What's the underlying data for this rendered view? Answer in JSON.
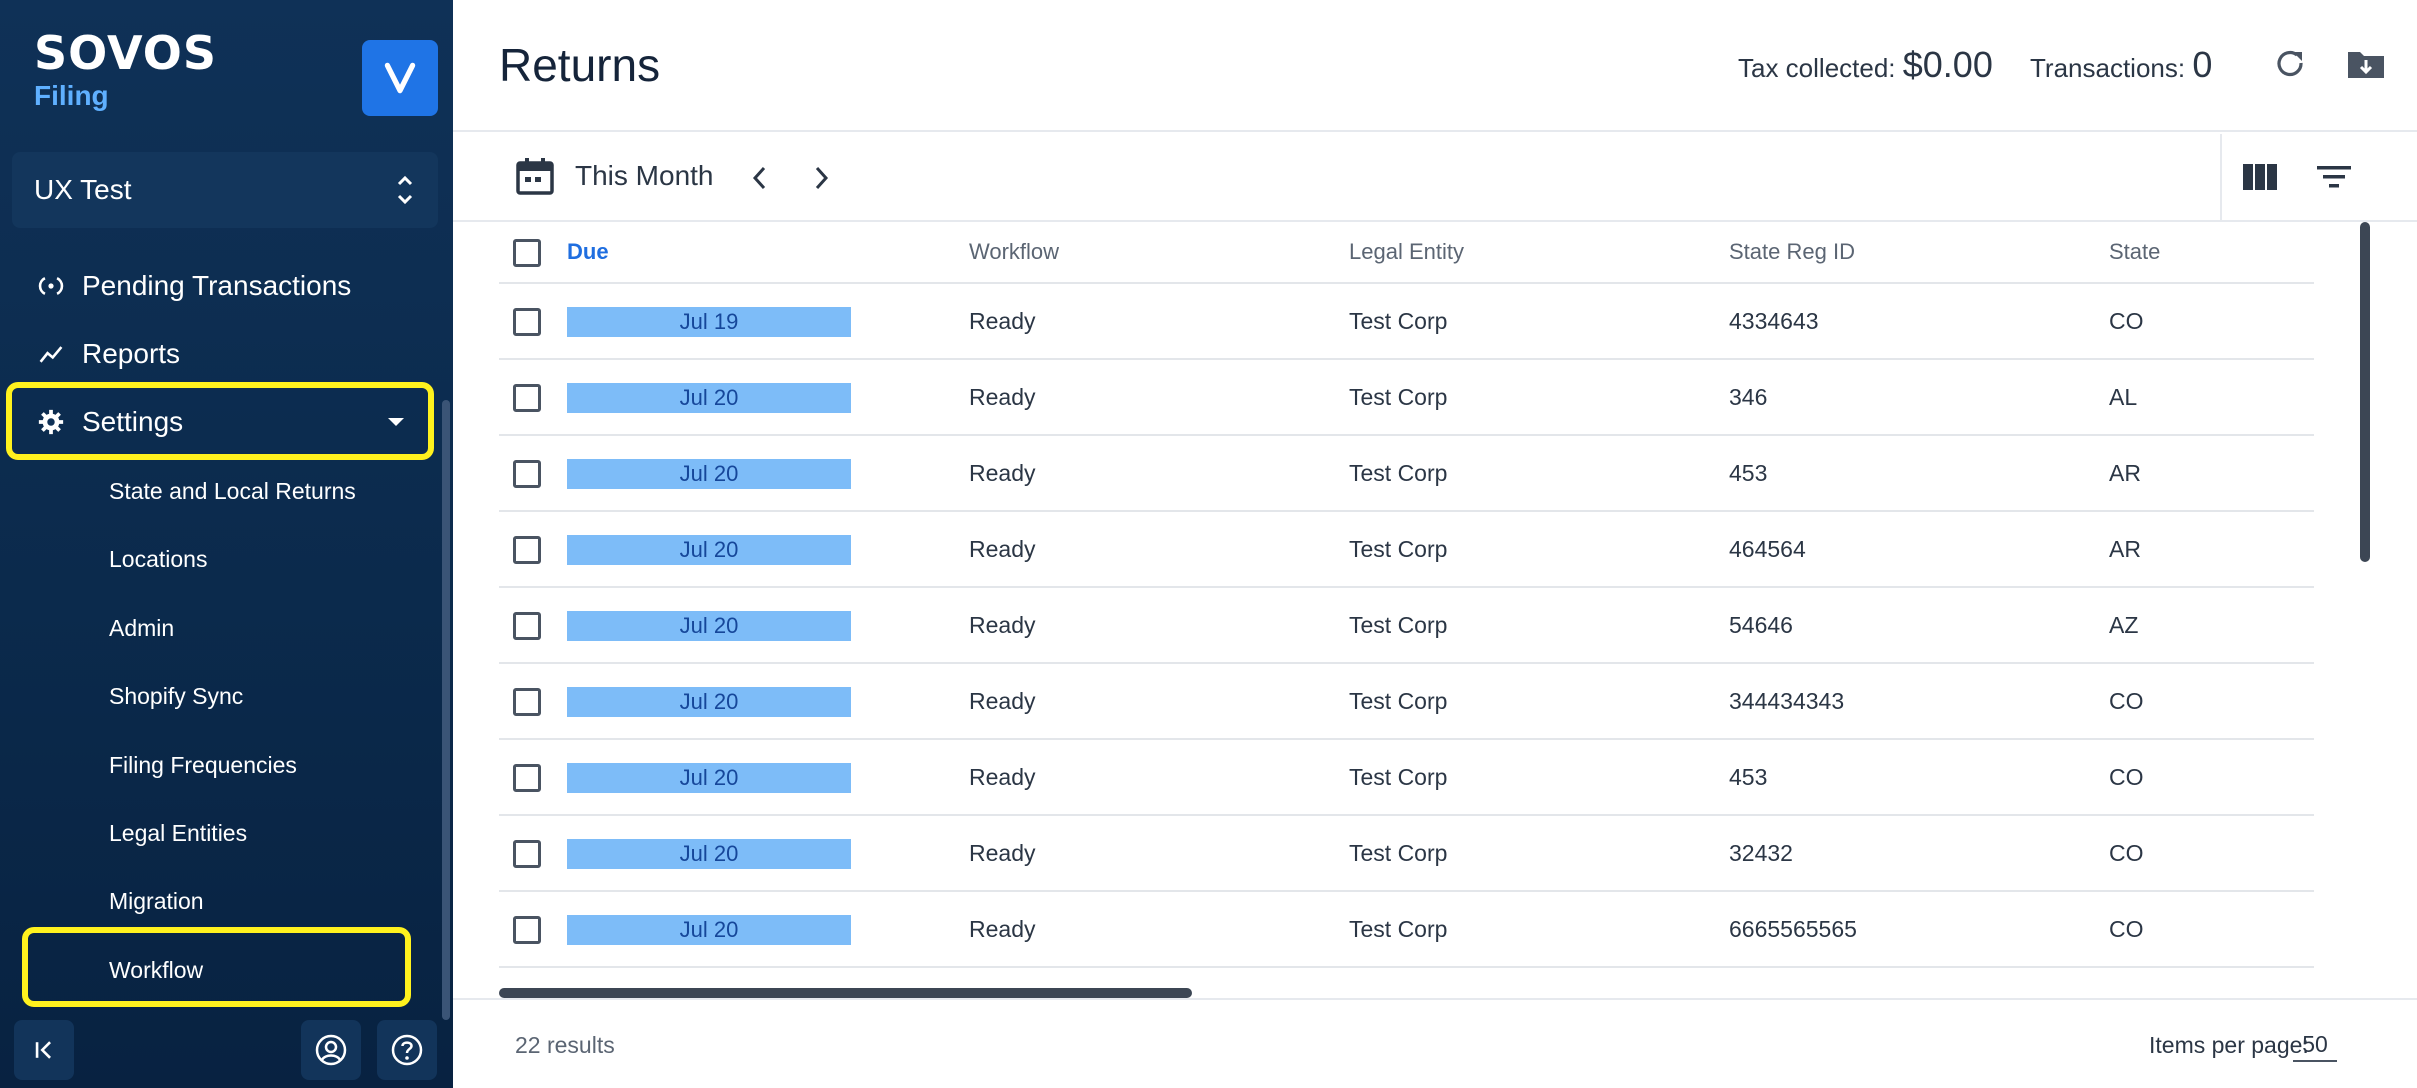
{
  "brand": {
    "logo": "SOVOS",
    "product": "Filing",
    "app_badge_letter": "V",
    "accent": "#1f74e6"
  },
  "org_selector": {
    "value": "UX Test"
  },
  "nav": {
    "pending": "Pending Transactions",
    "reports": "Reports",
    "settings": "Settings",
    "settings_children": [
      "State and Local Returns",
      "Locations",
      "Admin",
      "Shopify Sync",
      "Filing Frequencies",
      "Legal Entities",
      "Migration",
      "Workflow"
    ]
  },
  "header": {
    "title": "Returns",
    "tax_label": "Tax collected:",
    "tax_value": "$0.00",
    "tx_label": "Transactions:",
    "tx_value": "0"
  },
  "toolbar": {
    "period": "This Month"
  },
  "table": {
    "columns": [
      "Due",
      "Workflow",
      "Legal Entity",
      "State Reg ID",
      "State"
    ],
    "rows": [
      {
        "due": "Jul 19",
        "workflow": "Ready",
        "entity": "Test Corp",
        "reg": "4334643",
        "state": "CO"
      },
      {
        "due": "Jul 20",
        "workflow": "Ready",
        "entity": "Test Corp",
        "reg": "346",
        "state": "AL"
      },
      {
        "due": "Jul 20",
        "workflow": "Ready",
        "entity": "Test Corp",
        "reg": "453",
        "state": "AR"
      },
      {
        "due": "Jul 20",
        "workflow": "Ready",
        "entity": "Test Corp",
        "reg": "464564",
        "state": "AR"
      },
      {
        "due": "Jul 20",
        "workflow": "Ready",
        "entity": "Test Corp",
        "reg": "54646",
        "state": "AZ"
      },
      {
        "due": "Jul 20",
        "workflow": "Ready",
        "entity": "Test Corp",
        "reg": "344434343",
        "state": "CO"
      },
      {
        "due": "Jul 20",
        "workflow": "Ready",
        "entity": "Test Corp",
        "reg": "453",
        "state": "CO"
      },
      {
        "due": "Jul 20",
        "workflow": "Ready",
        "entity": "Test Corp",
        "reg": "32432",
        "state": "CO"
      },
      {
        "due": "Jul 20",
        "workflow": "Ready",
        "entity": "Test Corp",
        "reg": "6665565565",
        "state": "CO"
      }
    ]
  },
  "footer": {
    "results": "22 results",
    "ipp_label": "Items per page:",
    "ipp_value": "50"
  }
}
